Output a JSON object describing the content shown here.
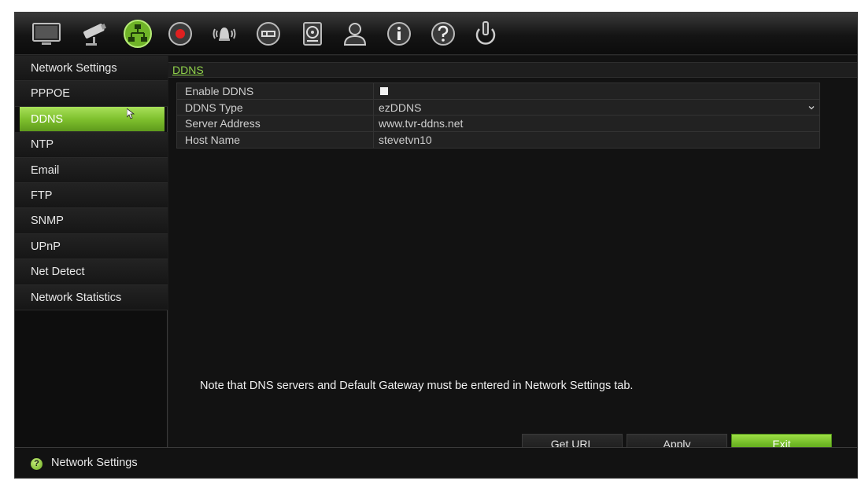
{
  "toolbar": {
    "icons": [
      {
        "name": "monitor-icon"
      },
      {
        "name": "camera-icon"
      },
      {
        "name": "network-icon",
        "active": true
      },
      {
        "name": "record-icon"
      },
      {
        "name": "alarm-icon"
      },
      {
        "name": "device-icon"
      },
      {
        "name": "hdd-icon"
      },
      {
        "name": "user-icon"
      },
      {
        "name": "info-icon"
      },
      {
        "name": "help-icon"
      },
      {
        "name": "power-icon"
      }
    ]
  },
  "sidebar": {
    "items": [
      {
        "label": "Network Settings"
      },
      {
        "label": "PPPOE"
      },
      {
        "label": "DDNS",
        "active": true
      },
      {
        "label": "NTP"
      },
      {
        "label": "Email"
      },
      {
        "label": "FTP"
      },
      {
        "label": "SNMP"
      },
      {
        "label": "UPnP"
      },
      {
        "label": "Net Detect"
      },
      {
        "label": "Network Statistics"
      }
    ]
  },
  "main": {
    "section_title": "DDNS",
    "form": {
      "enable_ddns_label": "Enable DDNS",
      "enable_ddns_checked": false,
      "ddns_type_label": "DDNS Type",
      "ddns_type_value": "ezDDNS",
      "server_address_label": "Server Address",
      "server_address_value": "www.tvr-ddns.net",
      "host_name_label": "Host Name",
      "host_name_value": "stevetvn10"
    },
    "note": "Note that DNS servers and Default Gateway must be entered in Network Settings tab.",
    "buttons": {
      "get_url": "Get URL",
      "apply": "Apply",
      "exit": "Exit"
    }
  },
  "statusbar": {
    "icon_glyph": "?",
    "text": "Network Settings"
  },
  "colors": {
    "accent": "#7fc12e",
    "section_title": "#8fd14a",
    "background": "#1c1c1c"
  }
}
